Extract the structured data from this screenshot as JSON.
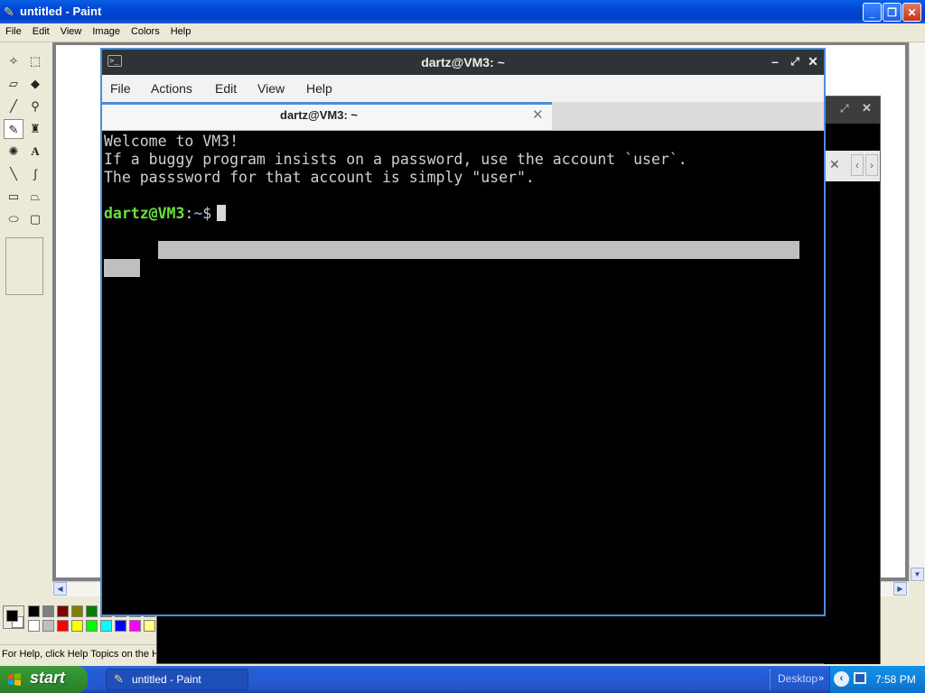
{
  "paint": {
    "title": "untitled - Paint",
    "menu": [
      "File",
      "Edit",
      "View",
      "Image",
      "Colors",
      "Help"
    ],
    "status": "For Help, click Help Topics on the Help Menu.",
    "palette": [
      "#000000",
      "#808080",
      "#800000",
      "#808000",
      "#008000",
      "#008080",
      "#000080",
      "#800080",
      "#808040",
      "#004040",
      "#0080ff",
      "#004080",
      "#ffffff",
      "#c0c0c0",
      "#ff0000",
      "#ffff00",
      "#00ff00",
      "#00ffff",
      "#0000ff",
      "#ff00ff",
      "#ffff80",
      "#00ff80",
      "#80ffff",
      "#8080ff"
    ],
    "foreground": "#000000",
    "background": "#ffffff"
  },
  "terminal": {
    "title": "dartz@VM3: ~",
    "menu": [
      "File",
      "Actions",
      "Edit",
      "View",
      "Help"
    ],
    "tab_label": "dartz@VM3: ~",
    "lines": [
      "Welcome to VM3!",
      "If a buggy program insists on a password, use the account `user`.",
      "The passsword for that account is simply \"user\"."
    ],
    "prompt": {
      "user_host": "dartz@VM3",
      "sep": ":",
      "path": "~",
      "symbol": "$"
    }
  },
  "taskbar": {
    "start_label": "start",
    "task_label": "untitled - Paint",
    "desktop_label": "Desktop",
    "clock": "7:58 PM"
  }
}
